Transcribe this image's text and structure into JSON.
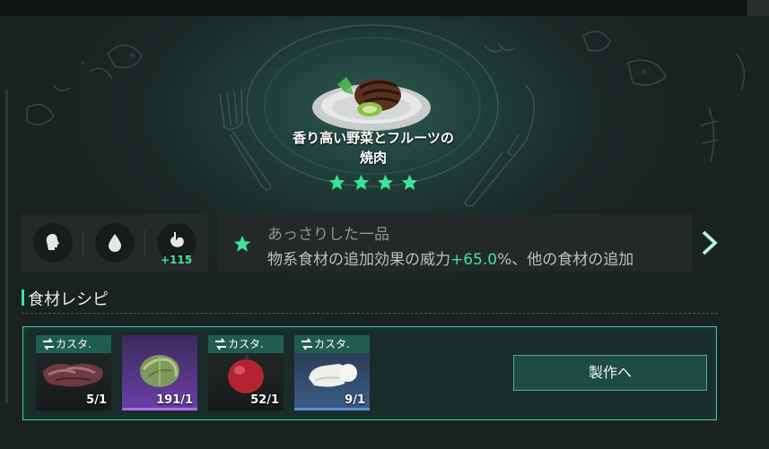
{
  "dish": {
    "title_line1": "香り高い野菜とフルーツの",
    "title_line2": "焼肉",
    "rating": 4,
    "plate_icon": "grilled-meat-plate-icon"
  },
  "stats": [
    {
      "icon": "head-icon",
      "value": ""
    },
    {
      "icon": "water-drop-icon",
      "value": ""
    },
    {
      "icon": "stomach-icon",
      "value": "+115"
    }
  ],
  "effect": {
    "title": "あっさりした一品",
    "desc_prefix": "物系食材の追加効果の威力",
    "desc_value": "+65.0",
    "desc_suffix": "%、他の食材の追加",
    "icon": "star-icon"
  },
  "recipe": {
    "section_title": "食材レシピ",
    "make_button": "製作へ",
    "ingredients": [
      {
        "name": "raw-meat",
        "tag": "カスタ.",
        "count": "5/1",
        "rarity": "common"
      },
      {
        "name": "cabbage",
        "tag": "",
        "count": "191/1",
        "rarity": "epic"
      },
      {
        "name": "apple",
        "tag": "カスタ.",
        "count": "52/1",
        "rarity": "common"
      },
      {
        "name": "cheese",
        "tag": "カスタ.",
        "count": "9/1",
        "rarity": "rare"
      }
    ]
  },
  "colors": {
    "accent": "#3ee39b",
    "panel_bg": "#1c2322",
    "tag_bg": "#1f5e4e"
  }
}
